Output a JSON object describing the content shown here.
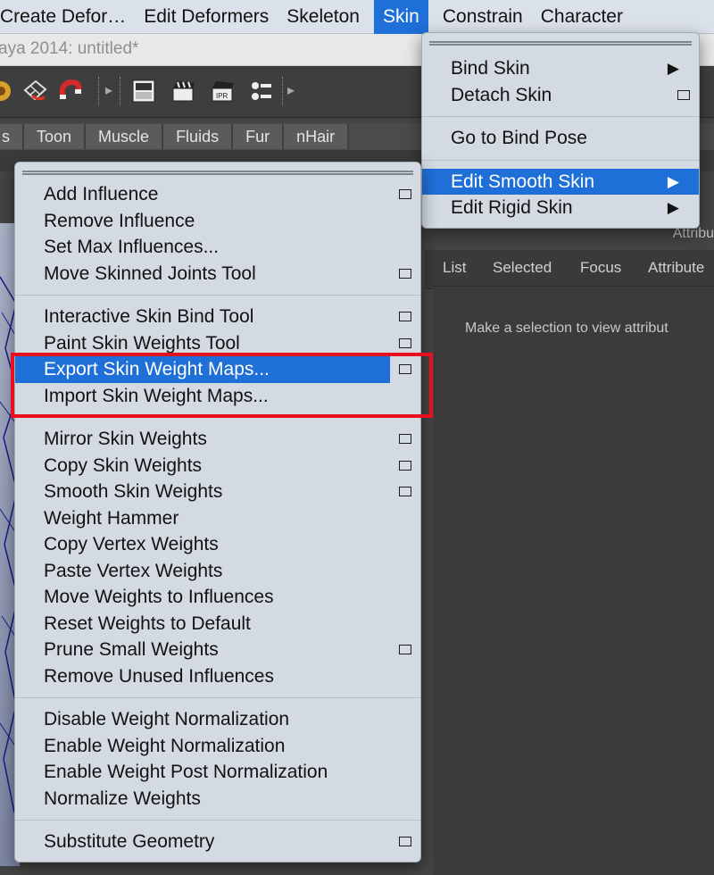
{
  "menubar": {
    "items": [
      "Create Defor…",
      "Edit Deformers",
      "Skeleton",
      "Skin",
      "Constrain",
      "Character"
    ],
    "active_index": 3
  },
  "title_bar": {
    "text": "aya 2014: untitled*"
  },
  "toolbar": {
    "icons": [
      "paint-tool-icon",
      "lattice-icon",
      "magnet-icon",
      "magnet-curve-icon",
      "render-view-icon",
      "clapboard-icon",
      "ipr-clapboard-icon",
      "render-settings-icon"
    ]
  },
  "shelf": {
    "tabs": [
      "s",
      "Toon",
      "Muscle",
      "Fluids",
      "Fur",
      "nHair"
    ]
  },
  "attribute_editor": {
    "title": "Attribu",
    "tabs": [
      "List",
      "Selected",
      "Focus",
      "Attribute"
    ],
    "hint": "Make a selection to view attribut"
  },
  "skin_menu": {
    "items": [
      {
        "label": "Bind Skin",
        "submenu": true
      },
      {
        "label": "Detach Skin",
        "option_box": true
      },
      {
        "separator": true
      },
      {
        "label": "Go to Bind Pose"
      },
      {
        "separator": true
      },
      {
        "label": "Edit Smooth Skin",
        "submenu": true,
        "highlighted": true
      },
      {
        "label": "Edit Rigid Skin",
        "submenu": true
      }
    ]
  },
  "smooth_skin_menu": {
    "groups": [
      [
        {
          "label": "Add Influence",
          "option_box": true
        },
        {
          "label": "Remove Influence"
        },
        {
          "label": "Set Max Influences..."
        },
        {
          "label": "Move Skinned Joints Tool",
          "option_box": true
        }
      ],
      [
        {
          "label": "Interactive Skin Bind Tool",
          "option_box": true
        },
        {
          "label": "Paint Skin Weights Tool",
          "option_box": true
        },
        {
          "label": "Export Skin Weight Maps...",
          "option_box": true,
          "highlighted": true
        },
        {
          "label": "Import Skin Weight Maps..."
        }
      ],
      [
        {
          "label": "Mirror Skin Weights",
          "option_box": true
        },
        {
          "label": "Copy Skin Weights",
          "option_box": true
        },
        {
          "label": "Smooth Skin Weights",
          "option_box": true
        },
        {
          "label": "Weight Hammer"
        },
        {
          "label": "Copy Vertex Weights"
        },
        {
          "label": "Paste Vertex Weights"
        },
        {
          "label": "Move Weights to Influences"
        },
        {
          "label": "Reset Weights to Default"
        },
        {
          "label": "Prune Small Weights",
          "option_box": true
        },
        {
          "label": "Remove Unused Influences"
        }
      ],
      [
        {
          "label": "Disable Weight Normalization"
        },
        {
          "label": "Enable Weight Normalization"
        },
        {
          "label": "Enable Weight Post Normalization"
        },
        {
          "label": "Normalize Weights"
        }
      ],
      [
        {
          "label": "Substitute Geometry",
          "option_box": true
        }
      ]
    ]
  },
  "colors": {
    "highlight": "#1f6fd8",
    "menu_bg": "#d3dae2",
    "annotation_box": "#e8101e",
    "viewport_wire": "#1a1a8c"
  }
}
